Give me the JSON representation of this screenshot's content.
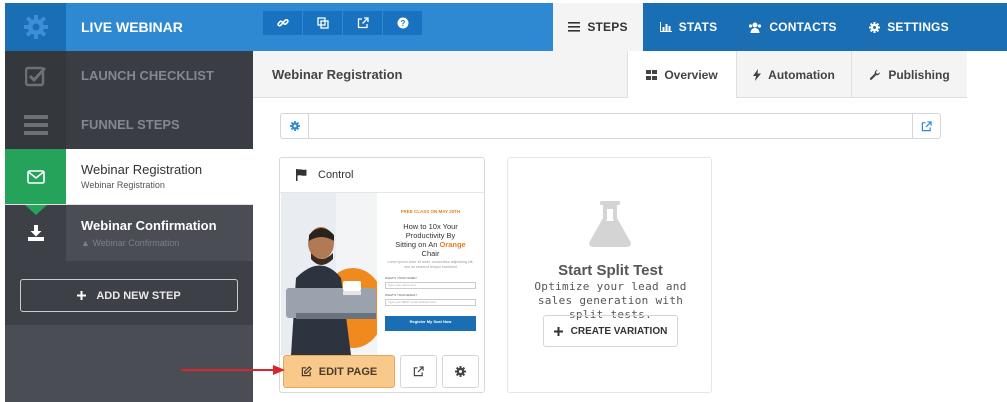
{
  "app": {
    "brand_label": "LIVE WEBINAR"
  },
  "toolbar": {
    "icons": [
      "link-icon",
      "copy-icon",
      "external-link-icon",
      "help-icon"
    ]
  },
  "nav": {
    "tabs": [
      {
        "label": "STEPS",
        "icon": "menu-icon",
        "active": true
      },
      {
        "label": "STATS",
        "icon": "bar-chart-icon",
        "active": false
      },
      {
        "label": "CONTACTS",
        "icon": "users-icon",
        "active": false
      },
      {
        "label": "SETTINGS",
        "icon": "gear-icon",
        "active": false
      }
    ]
  },
  "sidebar": {
    "launch_checklist": "LAUNCH CHECKLIST",
    "funnel_steps": "FUNNEL STEPS",
    "steps": [
      {
        "title": "Webinar Registration",
        "subtitle": "Webinar Registration"
      },
      {
        "title": "Webinar Confirmation",
        "subtitle": "Webinar Confirmation"
      }
    ],
    "add_step_label": "ADD NEW STEP"
  },
  "header": {
    "title": "Webinar Registration",
    "subtabs": [
      {
        "label": "Overview",
        "icon": "grid-icon",
        "active": true
      },
      {
        "label": "Automation",
        "icon": "bolt-icon",
        "active": false
      },
      {
        "label": "Publishing",
        "icon": "wrench-icon",
        "active": false
      }
    ]
  },
  "url_bar": {
    "value": ""
  },
  "variant": {
    "label": "Control",
    "preview": {
      "header": "FREE CLASS ON MAY 20TH",
      "headline_1": "How to 10x Your",
      "headline_2": "Productivity By",
      "headline_3": "Sitting on An",
      "headline_orange": "Orange",
      "headline_4": "Chair",
      "body": "Lorem ipsum dolor sit amet, consectetur adipisicing elit, sed do eiusmod tempor incididunt",
      "field1_label": "WHAT'S YOUR NAME?",
      "field1_placeholder": "Type your name here",
      "field2_label": "WHAT'S YOUR EMAIL?",
      "field2_placeholder": "Type your BEST email address here",
      "cta": "Register My Seat Now"
    },
    "edit_label": "EDIT PAGE"
  },
  "split_test": {
    "title": "Start Split Test",
    "description": "Optimize your lead and sales generation with split tests.",
    "button_label": "CREATE VARIATION"
  },
  "colors": {
    "brand_blue": "#2f89d2",
    "nav_blue": "#1a6fb4",
    "active_green": "#25a35a",
    "edit_orange": "#f8c98b",
    "sidebar_dark": "#3d4046"
  }
}
